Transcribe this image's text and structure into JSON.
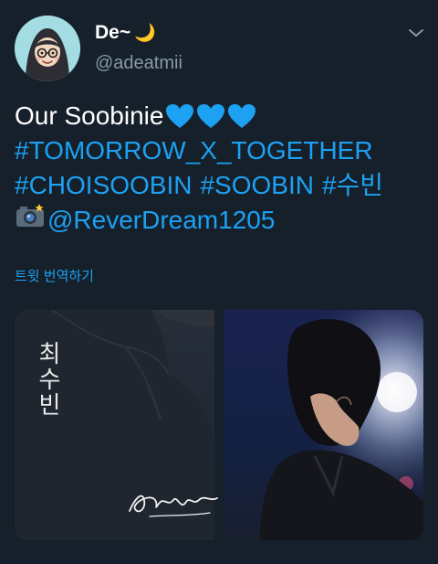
{
  "author": {
    "display_name": "De~",
    "moon_emoji": "🌙",
    "handle": "@adeatmii",
    "avatar_icon": "hijab-girl-avatar"
  },
  "tweet": {
    "line1_text": "Our Soobinie",
    "hearts": [
      "💙",
      "💙",
      "💙"
    ],
    "hashtag1": "#TOMORROW_X_TOGETHER",
    "hashtag2": "#CHOISOOBIN",
    "hashtag3": "#SOOBIN",
    "hashtag4": "#수빈",
    "camera_emoji": "📸",
    "mention": "@ReverDream1205",
    "translate_label": "트윗 번역하기"
  },
  "media": {
    "left_photo": {
      "overlay_text": "최수빈",
      "signature_icon": "autograph-signature"
    },
    "right_photo": {
      "description_icon": "profile-photo"
    }
  },
  "colors": {
    "background": "#15202b",
    "link": "#1da1f2",
    "secondary_text": "#8899a6",
    "heart": "#1da1f2"
  }
}
